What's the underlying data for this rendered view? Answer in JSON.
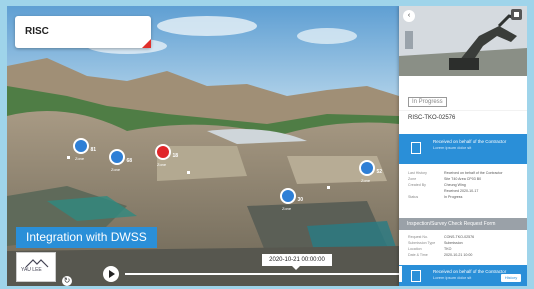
{
  "risc_card": {
    "title": "RISC"
  },
  "markers": [
    {
      "color": "blue",
      "badge": "81",
      "tag": "Zone"
    },
    {
      "color": "blue",
      "badge": "68",
      "tag": "Zone"
    },
    {
      "color": "red",
      "badge": "18",
      "tag": "Zone"
    },
    {
      "color": "blue",
      "badge": "52",
      "tag": "Zone"
    },
    {
      "color": "blue",
      "badge": "30",
      "tag": "Zone"
    }
  ],
  "banner": {
    "label": "Integration with DWSS"
  },
  "logo": {
    "text": "YAU LEE"
  },
  "timeline": {
    "tooltip": "2020-10-21 00:00:00"
  },
  "panel": {
    "status": "In Progress",
    "reference": "RISC-TKO-02576",
    "received": {
      "title": "Received on behalf of the Contractor",
      "subtitle": "Lorem ipsum dolor sit"
    },
    "details": [
      {
        "key": "Last History",
        "value": "Received on behalf of the Contractor"
      },
      {
        "key": "Zone",
        "value": "Site T40 Area CP03 B0"
      },
      {
        "key": "Created By",
        "value": "Cheung Wing"
      },
      {
        "key": "",
        "value": "Received 2020-10-17"
      },
      {
        "key": "Status",
        "value": "In Progress"
      }
    ],
    "section_title": "Inspection/Survey Check Request Form",
    "form": [
      {
        "key": "Request No.",
        "value": "CONS-TKO-02576"
      },
      {
        "key": "Submission Type",
        "value": "Submission"
      },
      {
        "key": "Location",
        "value": "TKO"
      },
      {
        "key": "Date & Time",
        "value": "2020-10-21 10:00"
      }
    ],
    "footer": {
      "title": "Received on behalf of the Contractor",
      "subtitle": "Lorem ipsum dolor sit",
      "history_label": "History"
    }
  },
  "colors": {
    "accent": "#2a8fd8",
    "alert": "#e0262a",
    "marker": "#2e7fd6"
  },
  "icons": [
    "chevron-left-icon",
    "layers-icon",
    "document-icon",
    "play-icon",
    "reset-icon"
  ]
}
